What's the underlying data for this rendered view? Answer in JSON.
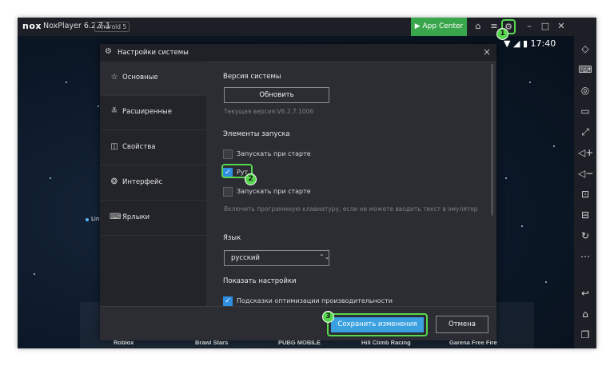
{
  "titlebar": {
    "logo": "nox",
    "app_title": "NoxPlayer 6.2.7.1",
    "android_badge": "Android 5",
    "app_center": "App Center"
  },
  "status_bar": {
    "time": "17:40"
  },
  "home": {
    "shortcut_label": "Lin",
    "games": [
      "Roblox",
      "Brawl Stars",
      "PUBG MOBILE",
      "Hill Climb Racing",
      "Garena Free Fire"
    ]
  },
  "dialog": {
    "title": "Настройки системы",
    "nav": [
      {
        "label": "Основные",
        "icon": "star-icon"
      },
      {
        "label": "Расширенные",
        "icon": "sliders-icon"
      },
      {
        "label": "Свойства",
        "icon": "panel-icon"
      },
      {
        "label": "Интерфейс",
        "icon": "interface-icon"
      },
      {
        "label": "Ярлыки",
        "icon": "keyboard-icon"
      }
    ],
    "system_version_heading": "Версия системы",
    "update_button": "Обновить",
    "current_version": "Текущая версия:V6.2.7.1006",
    "startup_heading": "Элементы запуска",
    "options": [
      {
        "label": "Запускать при старте",
        "checked": false
      },
      {
        "label": "Рут",
        "checked": true
      },
      {
        "label": "Запускать при старте",
        "checked": false
      }
    ],
    "keyboard_hint": "Включить программную клавиатуру, если не можете вводить текст в эмулятор",
    "language_heading": "Язык",
    "language_value": "русский",
    "show_settings_heading": "Показать настройки",
    "optimization_tips": {
      "label": "Подсказки оптимизации производительности",
      "checked": true
    },
    "save_button": "Сохранить изменения",
    "cancel_button": "Отмена"
  },
  "markers": [
    "1",
    "2",
    "3"
  ],
  "colors": {
    "accent_green": "#56d74d",
    "primary_blue": "#3aa0e0",
    "app_center_green": "#3aa64b"
  }
}
